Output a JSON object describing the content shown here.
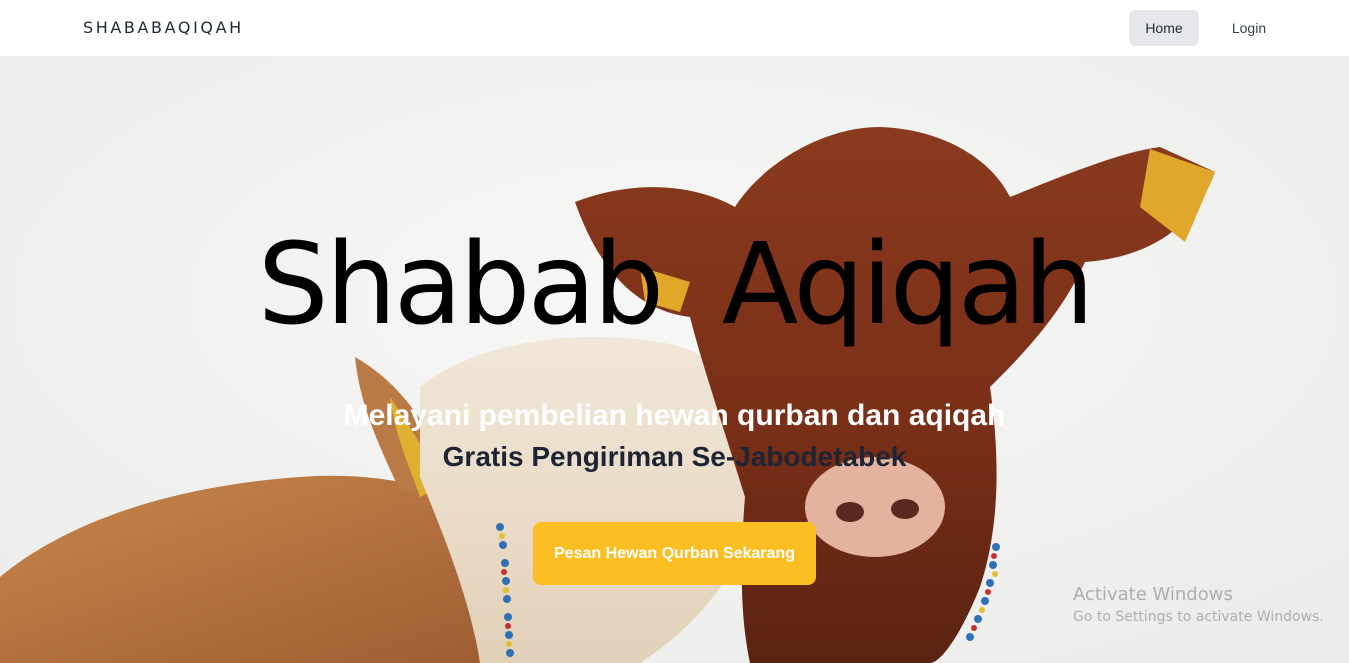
{
  "navbar": {
    "brand": "SHABABAQIQAH",
    "links": [
      {
        "label": "Home",
        "active": true
      },
      {
        "label": "Login",
        "active": false
      }
    ]
  },
  "hero": {
    "title": "Shabab Aqiqah",
    "subtitle": "Melayani pembelian hewan qurban dan aqiqah",
    "tagline": "Gratis Pengiriman Se-Jabodetabek",
    "cta_label": "Pesan Hewan Qurban Sekarang",
    "background_image": "two cows (brown cow and light calf) against white sky"
  },
  "os_watermark": {
    "title": "Activate Windows",
    "subtitle": "Go to Settings to activate Windows."
  },
  "colors": {
    "accent": "#fbbf24",
    "nav_active_bg": "#e5e7eb",
    "title": "#000000",
    "tagline": "#1e2433"
  }
}
